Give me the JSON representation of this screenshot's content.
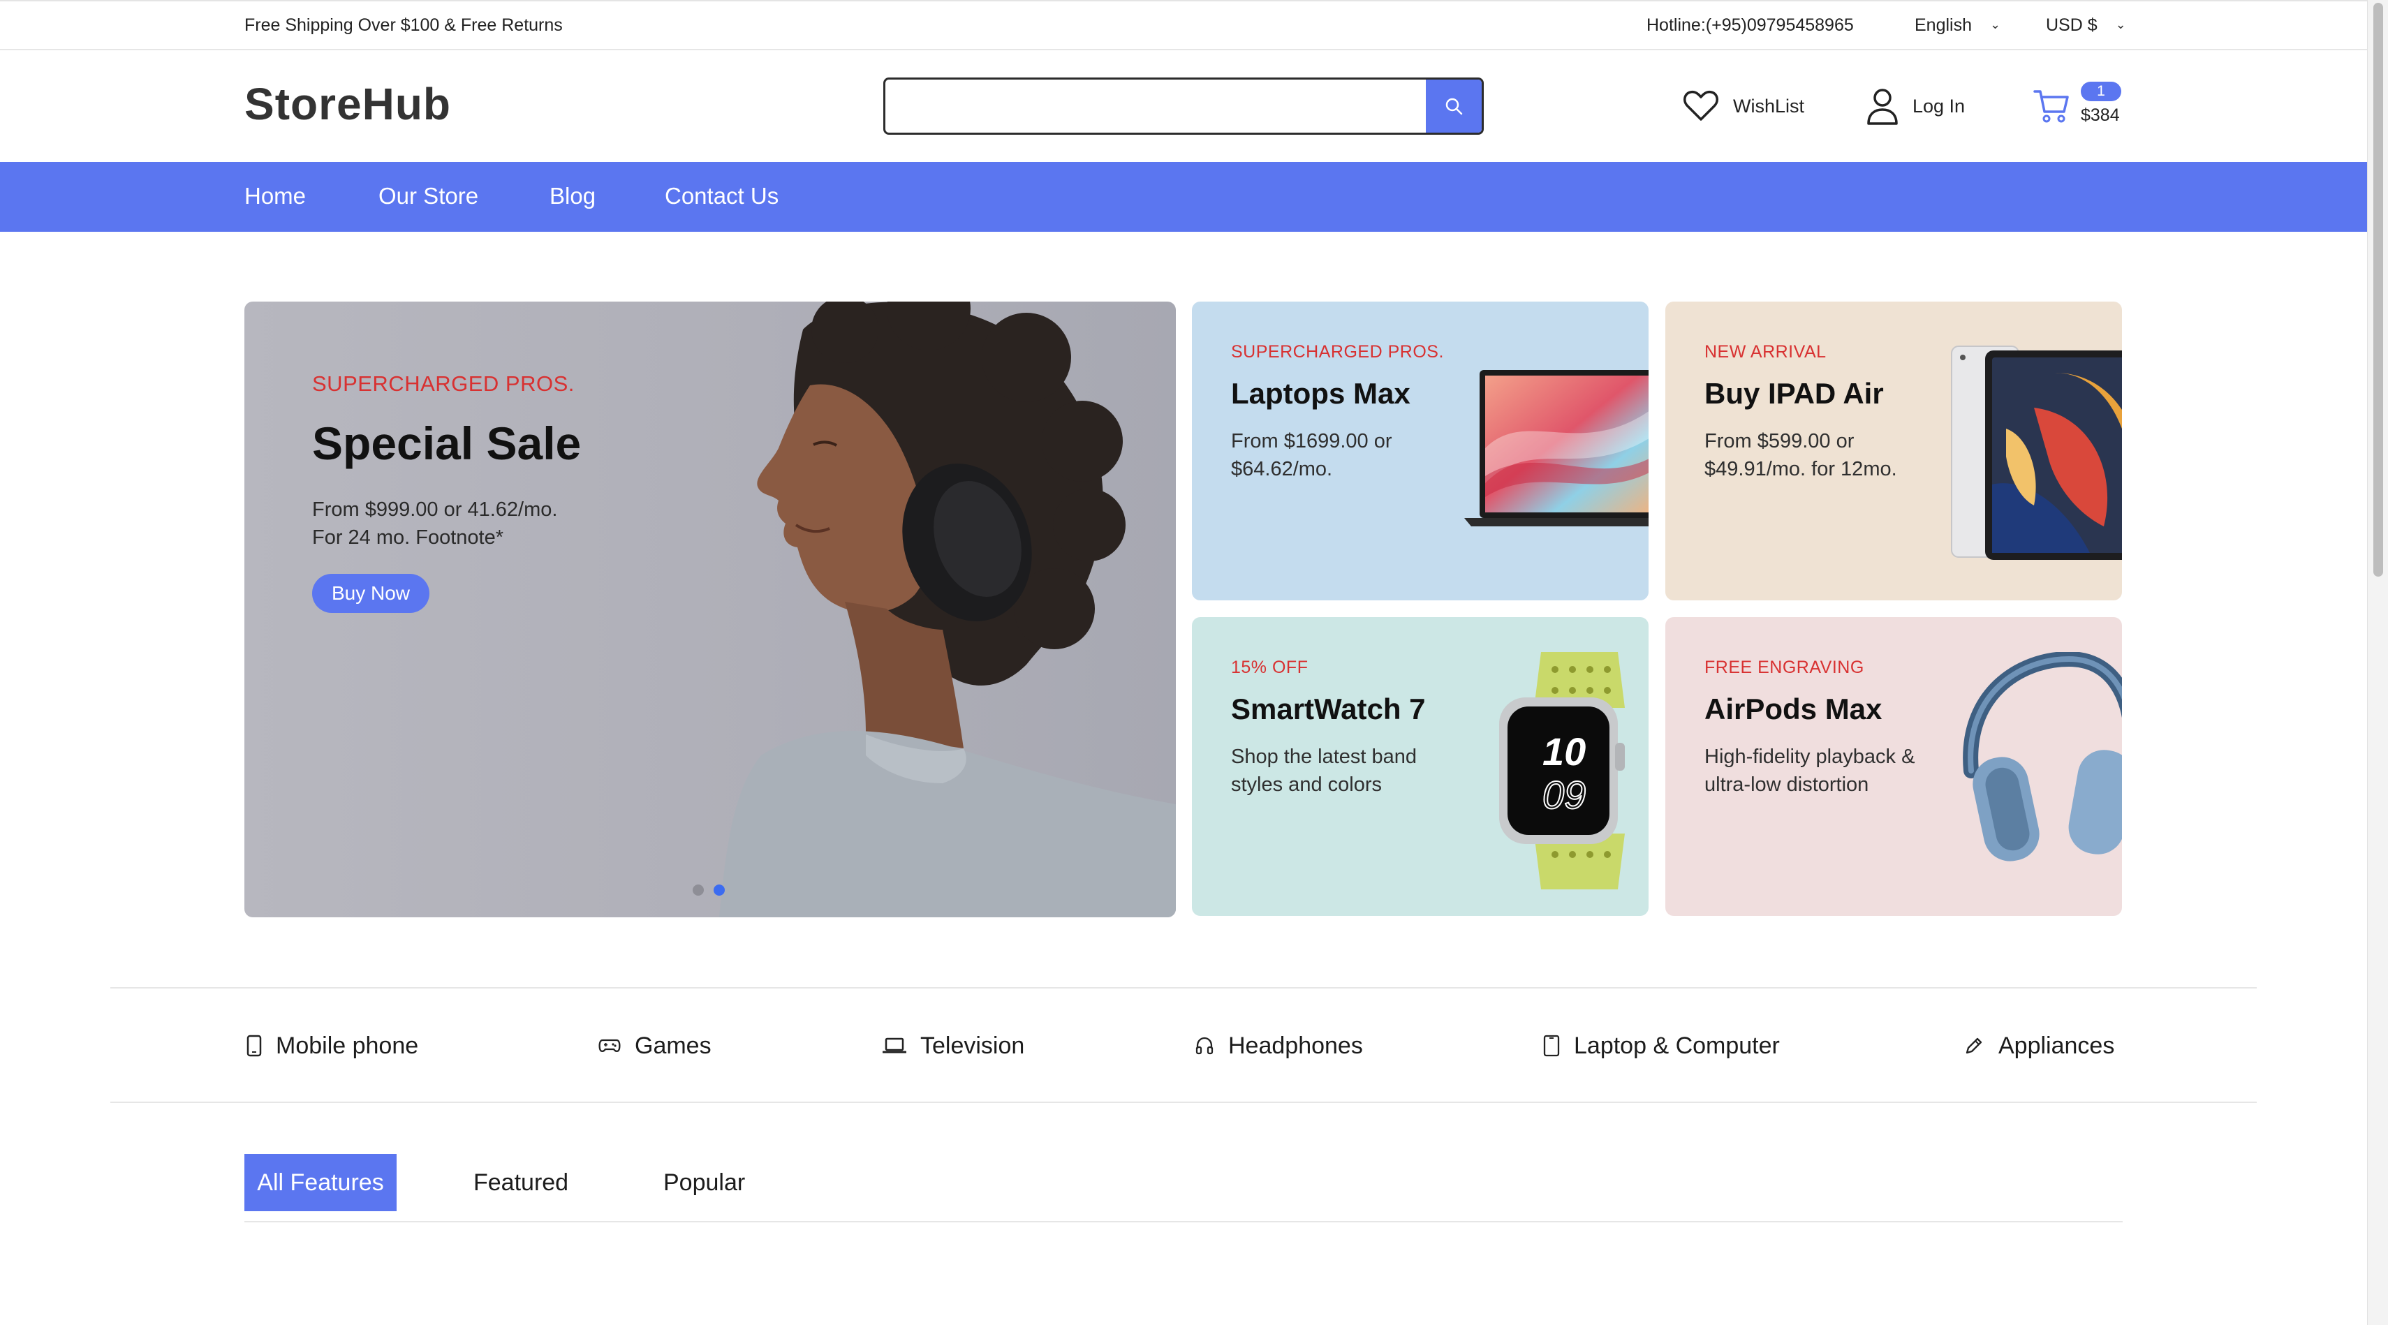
{
  "topbar": {
    "shipping_text": "Free Shipping Over $100 & Free Returns",
    "hotline": "Hotline:(+95)09795458965",
    "language": "English",
    "currency": "USD $"
  },
  "header": {
    "logo": "StoreHub",
    "search_placeholder": "",
    "wishlist_label": "WishList",
    "login_label": "Log In",
    "cart_count": "1",
    "cart_total": "$384"
  },
  "nav": {
    "items": [
      "Home",
      "Our Store",
      "Blog",
      "Contact Us"
    ]
  },
  "hero": {
    "eyebrow": "SUPERCHARGED PROS.",
    "title": "Special Sale",
    "desc_line1": "From $999.00 or 41.62/mo.",
    "desc_line2": "For 24 mo. Footnote*",
    "button": "Buy Now",
    "slides": 2,
    "active_slide": 2
  },
  "promos": [
    {
      "eyebrow": "SUPERCHARGED PROS.",
      "title": "Laptops Max",
      "line1": "From $1699.00 or",
      "line2": "$64.62/mo.",
      "image": "laptop-image"
    },
    {
      "eyebrow": "NEW ARRIVAL",
      "title": "Buy IPAD Air",
      "line1": "From $599.00 or",
      "line2": "$49.91/mo. for 12mo.",
      "image": "ipad-image"
    },
    {
      "eyebrow": "15% OFF",
      "title": "SmartWatch 7",
      "line1": "Shop the latest band",
      "line2": "styles and colors",
      "image": "smartwatch-image",
      "watch_face_hour": "10",
      "watch_face_min": "09"
    },
    {
      "eyebrow": "FREE ENGRAVING",
      "title": "AirPods Max",
      "line1": "High-fidelity playback &",
      "line2": "ultra-low distortion",
      "image": "headphones-image"
    }
  ],
  "categories": [
    {
      "label": "Mobile phone",
      "icon": "mobile-phone-icon"
    },
    {
      "label": "Games",
      "icon": "gamepad-icon"
    },
    {
      "label": "Television",
      "icon": "laptop-icon"
    },
    {
      "label": "Headphones",
      "icon": "headphones-icon"
    },
    {
      "label": "Laptop & Computer",
      "icon": "tablet-icon"
    },
    {
      "label": "Appliances",
      "icon": "pen-icon"
    }
  ],
  "tabs": {
    "items": [
      "All Features",
      "Featured",
      "Popular"
    ],
    "active": "All Features"
  },
  "colors": {
    "accent": "#5b76f0",
    "eyebrow_red": "#d83131",
    "laptop_card": "#c4dcee",
    "ipad_card": "#efe2d3",
    "watch_card": "#cce7e5",
    "airpods_card": "#f0dede"
  }
}
